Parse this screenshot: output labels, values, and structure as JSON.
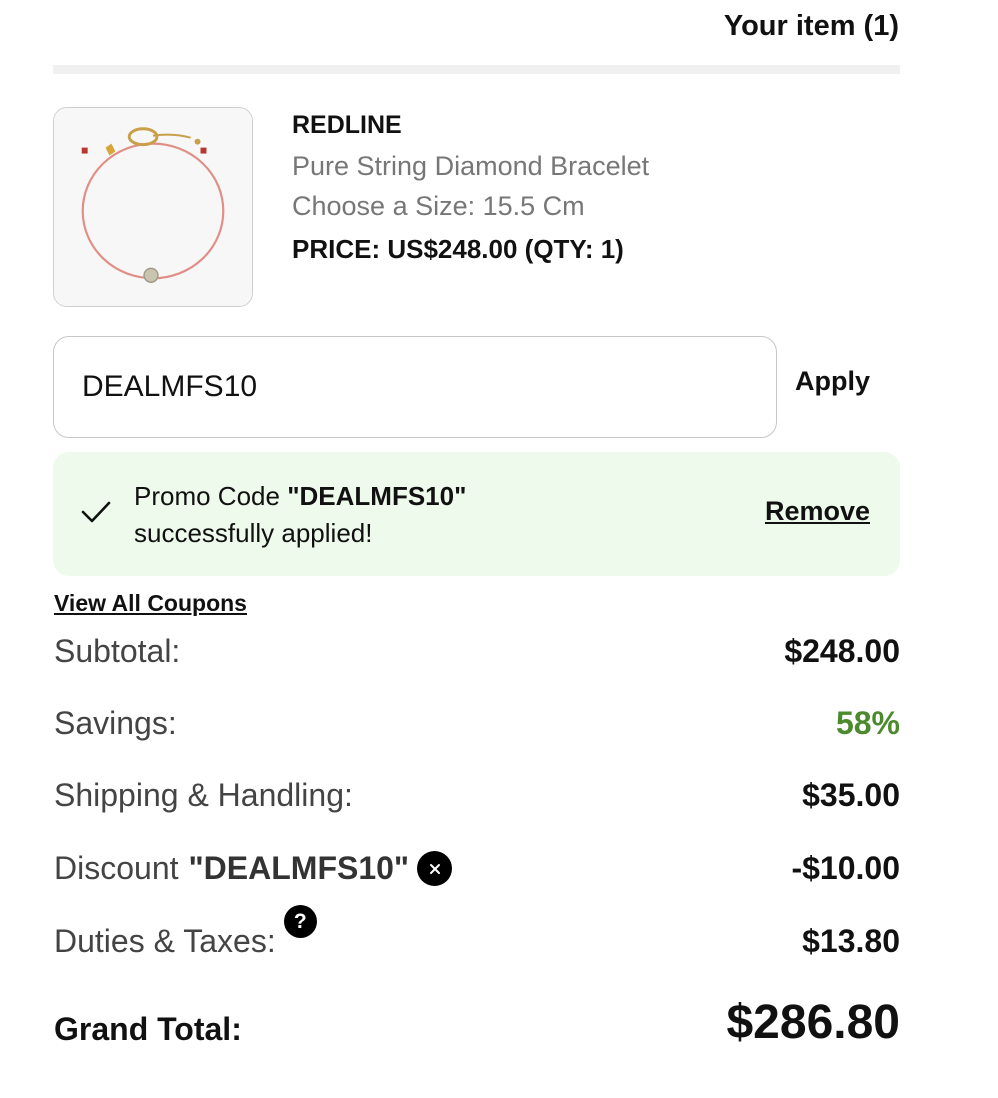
{
  "header": {
    "title": "Your item (1)"
  },
  "item": {
    "brand": "REDLINE",
    "name": "Pure String Diamond Bracelet",
    "size_line": "Choose a Size: 15.5 Cm",
    "price_line": "PRICE: US$248.00 (QTY: 1)",
    "image_icon": "bracelet-product-image"
  },
  "promo": {
    "input_value": "DEALMFS10",
    "apply_label": "Apply",
    "success_prefix": "Promo Code ",
    "success_code": "\"DEALMFS10\"",
    "success_suffix": "successfully applied!",
    "remove_label": "Remove",
    "banner_color": "#eefaec"
  },
  "coupons_link": "View All Coupons",
  "summary": {
    "subtotal": {
      "label": "Subtotal:",
      "value": "$248.00"
    },
    "savings": {
      "label": "Savings:",
      "value": "58%",
      "color": "#4c8a2e"
    },
    "shipping": {
      "label": "Shipping & Handling:",
      "value": "$35.00"
    },
    "discount": {
      "label": "Discount",
      "code": "\"DEALMFS10\"",
      "value": "-$10.00"
    },
    "duties": {
      "label": "Duties & Taxes:",
      "value": "$13.80",
      "help_glyph": "?"
    },
    "grand_total": {
      "label": "Grand Total:",
      "value": "$286.80"
    }
  },
  "icons": {
    "check": "check-icon",
    "remove_discount": "close-circle-icon",
    "help": "question-circle-icon"
  }
}
